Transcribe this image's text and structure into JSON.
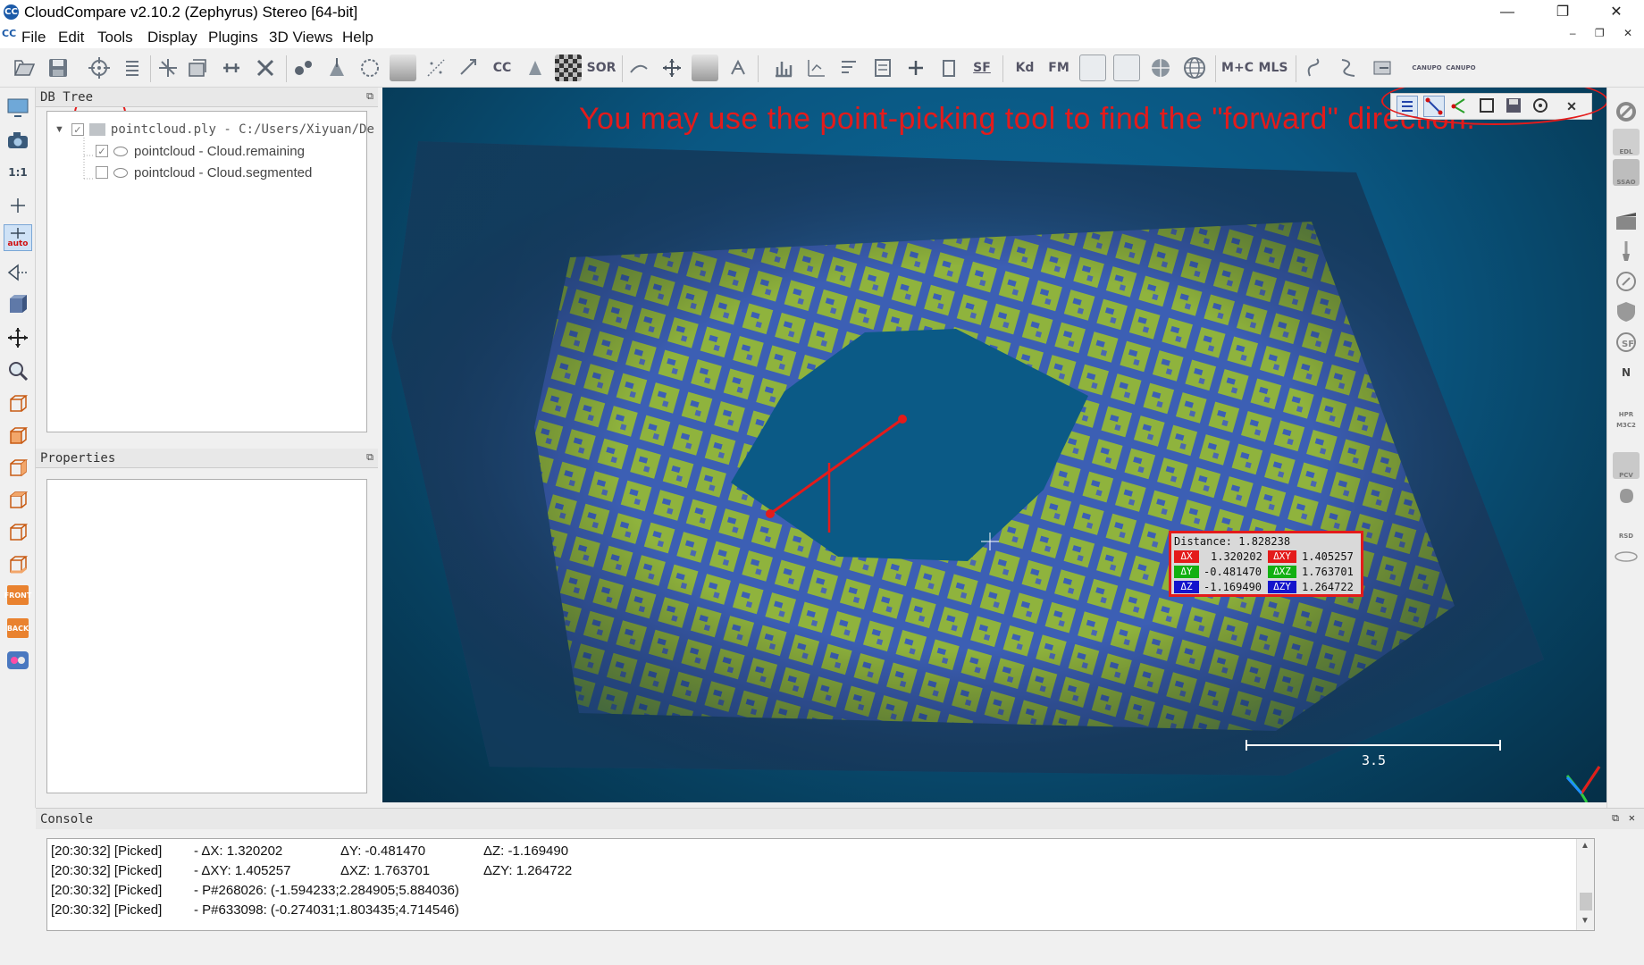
{
  "window": {
    "title": "CloudCompare v2.10.2 (Zephyrus) Stereo [64-bit]",
    "logo": "CC",
    "minimize": "—",
    "maximize": "❐",
    "close": "✕"
  },
  "menu": [
    "File",
    "Edit",
    "Tools",
    "Display",
    "Plugins",
    "3D Views",
    "Help"
  ],
  "mdi_controls": "– ❐ ✕",
  "toolbar_labels": {
    "cc": "CC",
    "sor": "SOR",
    "sf": "SF",
    "kd": "Kd",
    "fm": "FM",
    "mc": "M+C",
    "mls": "MLS",
    "canupo1": "CANUPO",
    "canupo2": "CANUPO"
  },
  "left_toolbar": {
    "one_to_one": "1:1",
    "auto": "auto",
    "front": "FRONT",
    "back": "BACK"
  },
  "db_tree": {
    "title": "DB Tree",
    "float_icon": "⧉",
    "items": [
      {
        "label": "pointcloud.ply - C:/Users/Xiyuan/De",
        "checked": true
      },
      {
        "label": "pointcloud - Cloud.remaining",
        "checked": true
      },
      {
        "label": "pointcloud - Cloud.segmented",
        "checked": false
      }
    ]
  },
  "properties": {
    "title": "Properties",
    "float_icon": "⧉"
  },
  "view": {
    "annotation": "You may use the point-picking tool to find the \"forward\" direction.",
    "scale_label": "3.5",
    "distance": {
      "title": "Distance: 1.828238",
      "dx_tag": "ΔX",
      "dx": "1.320202",
      "dxy_tag": "ΔXY",
      "dxy": "1.405257",
      "dy_tag": "ΔY",
      "dy": "-0.481470",
      "dxz_tag": "ΔXZ",
      "dxz": "1.763701",
      "dz_tag": "ΔZ",
      "dz": "-1.169490",
      "dzy_tag": "ΔZY",
      "dzy": "1.264722"
    },
    "colors": {
      "red_tag": "#e41b1b",
      "green_tag": "#12b012",
      "blue_tag": "#1414cc",
      "annotation": "#e41b1b"
    }
  },
  "right_toolbar": {
    "north": "N",
    "labels": [
      "EDL",
      "SSAO",
      "HPR",
      "M3C2",
      "PCV",
      "RSD"
    ]
  },
  "picking_panel": {
    "close": "✕"
  },
  "console": {
    "title": "Console",
    "float_icon": "⧉",
    "close_icon": "✕",
    "rows": [
      {
        "time": "[20:30:32] [Picked]",
        "a": "- ΔX: 1.320202",
        "b": "ΔY: -0.481470",
        "c": "ΔZ: -1.169490"
      },
      {
        "time": "[20:30:32] [Picked]",
        "a": "- ΔXY: 1.405257",
        "b": "ΔXZ: 1.763701",
        "c": "ΔZY: 1.264722"
      },
      {
        "time": "[20:30:32] [Picked]",
        "a": "- P#268026: (-1.594233;2.284905;5.884036)",
        "b": "",
        "c": ""
      },
      {
        "time": "[20:30:32] [Picked]",
        "a": "- P#633098: (-0.274031;1.803435;4.714546)",
        "b": "",
        "c": ""
      }
    ]
  }
}
